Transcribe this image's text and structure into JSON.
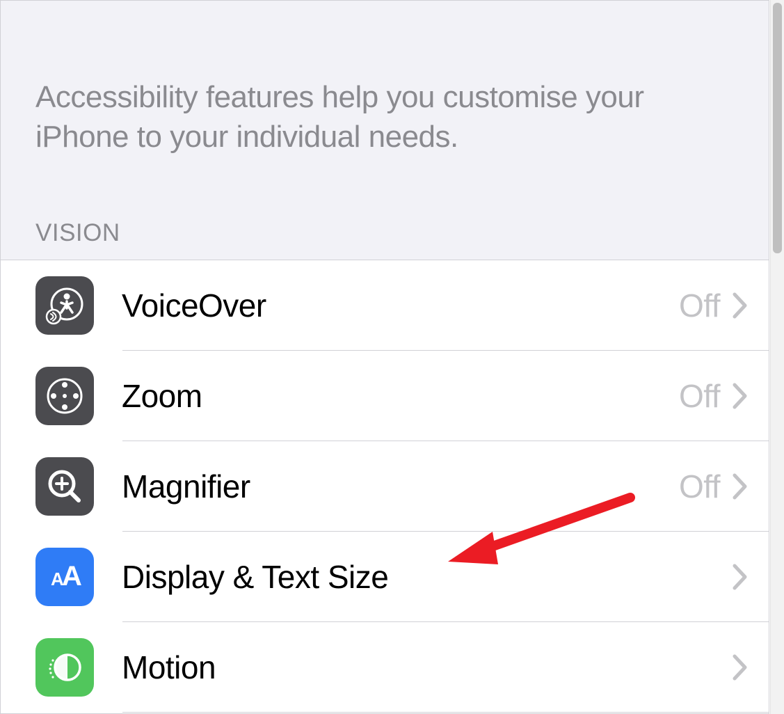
{
  "header": {
    "description": "Accessibility features help you customise your iPhone to your individual needs."
  },
  "section": {
    "title": "VISION"
  },
  "rows": [
    {
      "label": "VoiceOver",
      "value": "Off",
      "icon": "voiceover-icon"
    },
    {
      "label": "Zoom",
      "value": "Off",
      "icon": "zoom-icon"
    },
    {
      "label": "Magnifier",
      "value": "Off",
      "icon": "magnifier-icon"
    },
    {
      "label": "Display & Text Size",
      "value": "",
      "icon": "textsize-icon"
    },
    {
      "label": "Motion",
      "value": "",
      "icon": "motion-icon"
    }
  ]
}
